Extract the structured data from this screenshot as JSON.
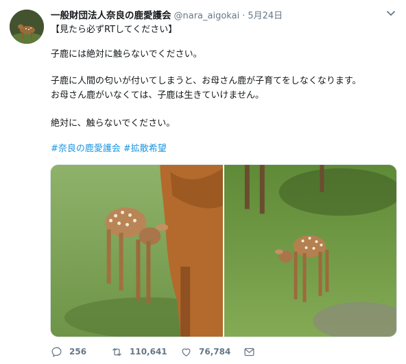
{
  "tweet": {
    "display_name": "一般財団法人奈良の鹿愛護会",
    "handle": "@nara_aigokai",
    "separator": "·",
    "date": "5月24日",
    "lines": [
      "【見たら必ずRTしてください】",
      "子鹿には絶対に触らないでください。",
      "子鹿に人間の匂いが付いてしまうと、お母さん鹿が子育てをしなくなります。",
      "お母さん鹿がいなくては、子鹿は生きていけません。",
      "絶対に、触らないでください。"
    ],
    "hashtags": [
      "#奈良の鹿愛護会",
      "#拡散希望"
    ]
  },
  "actions": {
    "replies": "256",
    "retweets": "110,641",
    "likes": "76,784"
  },
  "icons": {
    "reply": "reply-icon",
    "retweet": "retweet-icon",
    "like": "heart-icon",
    "dm": "envelope-icon",
    "menu": "chevron-down-icon"
  },
  "colors": {
    "text": "#14171a",
    "secondary": "#657786",
    "link": "#1b95e0",
    "border": "#e1e8ed"
  }
}
